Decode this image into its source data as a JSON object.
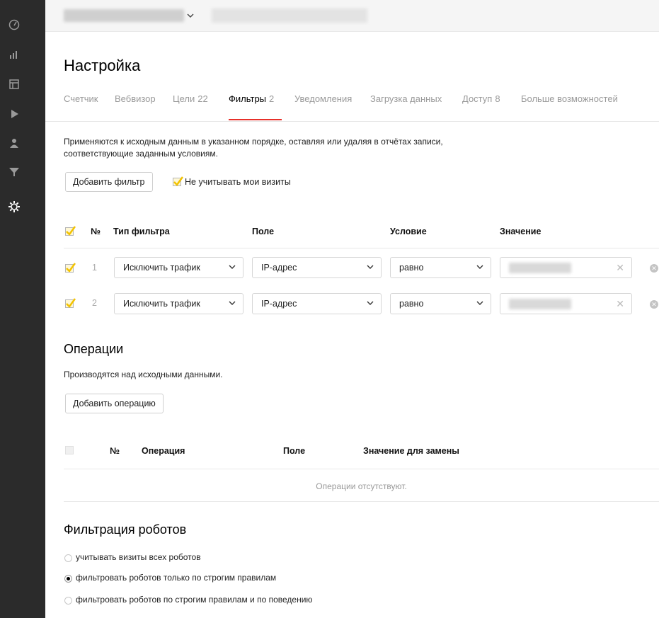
{
  "page": {
    "title": "Настройка"
  },
  "tabs": [
    {
      "label": "Счетчик",
      "count": ""
    },
    {
      "label": "Вебвизор",
      "count": ""
    },
    {
      "label": "Цели",
      "count": "22"
    },
    {
      "label": "Фильтры",
      "count": "2",
      "active": true
    },
    {
      "label": "Уведомления",
      "count": ""
    },
    {
      "label": "Загрузка данных",
      "count": ""
    },
    {
      "label": "Доступ",
      "count": "8"
    },
    {
      "label": "Больше возможностей",
      "count": ""
    }
  ],
  "filters": {
    "description_line1": "Применяются к исходным данным в указанном порядке, оставляя или удаляя в отчётах записи,",
    "description_line2": "соответствующие заданным условиям.",
    "add_button": "Добавить фильтр",
    "ignore_my_visits_label": "Не учитывать мои визиты",
    "ignore_my_visits_checked": true,
    "columns": {
      "number": "№",
      "type": "Тип фильтра",
      "field": "Поле",
      "condition": "Условие",
      "value": "Значение"
    },
    "rows": [
      {
        "number": "1",
        "type": "Исключить трафик",
        "field": "IP-адрес",
        "condition": "равно",
        "checked": true
      },
      {
        "number": "2",
        "type": "Исключить трафик",
        "field": "IP-адрес",
        "condition": "равно",
        "checked": true
      }
    ]
  },
  "operations": {
    "title": "Операции",
    "description": "Производятся над исходными данными.",
    "add_button": "Добавить операцию",
    "columns": {
      "number": "№",
      "operation": "Операция",
      "field": "Поле",
      "replace_value": "Значение для замены"
    },
    "empty_message": "Операции отсутствуют."
  },
  "robots": {
    "title": "Фильтрация роботов",
    "options": [
      {
        "label": "учитывать визиты всех роботов",
        "selected": false
      },
      {
        "label": "фильтровать роботов только по строгим правилам",
        "selected": true
      },
      {
        "label": "фильтровать роботов по строгим правилам и по поведению",
        "selected": false
      }
    ]
  },
  "colors": {
    "accent": "#e7302a",
    "sidebar": "#2b2b2b",
    "checkmark": "#f2c200"
  },
  "sidebar_icons": [
    "dashboard-icon",
    "reports-icon",
    "summary-icon",
    "webvisor-icon",
    "audience-icon",
    "funnel-icon",
    "settings-icon"
  ]
}
